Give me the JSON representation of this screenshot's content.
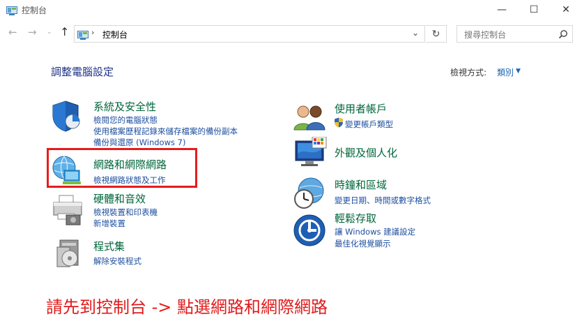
{
  "window": {
    "title": "控制台",
    "minimize": "—",
    "maximize": "☐",
    "close": "✕"
  },
  "nav": {
    "back": "←",
    "forward": "→",
    "recent": "⌄",
    "up": "↑",
    "address_separator": "›",
    "address": "控制台",
    "dropdown": "⌄",
    "refresh": "↻",
    "search_placeholder": "搜尋控制台"
  },
  "main": {
    "title": "調整電腦設定",
    "view_by_label": "檢視方式:",
    "view_by_value": "類別",
    "view_by_arrow": "▼"
  },
  "left_categories": [
    {
      "title": "系統及安全性",
      "links": [
        "檢閱您的電腦狀態",
        "使用檔案歷程記錄來儲存檔案的備份副本",
        "備份與還原 (Windows 7)"
      ]
    },
    {
      "title": "網路和網際網路",
      "links": [
        "檢視網路狀態及工作"
      ]
    },
    {
      "title": "硬體和音效",
      "links": [
        "檢視裝置和印表機",
        "新增裝置"
      ]
    },
    {
      "title": "程式集",
      "links": [
        "解除安裝程式"
      ]
    }
  ],
  "right_categories": [
    {
      "title": "使用者帳戶",
      "links": [
        "變更帳戶類型"
      ]
    },
    {
      "title": "外觀及個人化",
      "links": []
    },
    {
      "title": "時鐘和區域",
      "links": [
        "變更日期、時間或數字格式"
      ]
    },
    {
      "title": "輕鬆存取",
      "links": [
        "讓 Windows 建議設定",
        "最佳化視覺顯示"
      ]
    }
  ],
  "annotation": {
    "instruction": "請先到控制台 -> 點選網路和網際網路",
    "highlight_color": "#e51c1c"
  }
}
